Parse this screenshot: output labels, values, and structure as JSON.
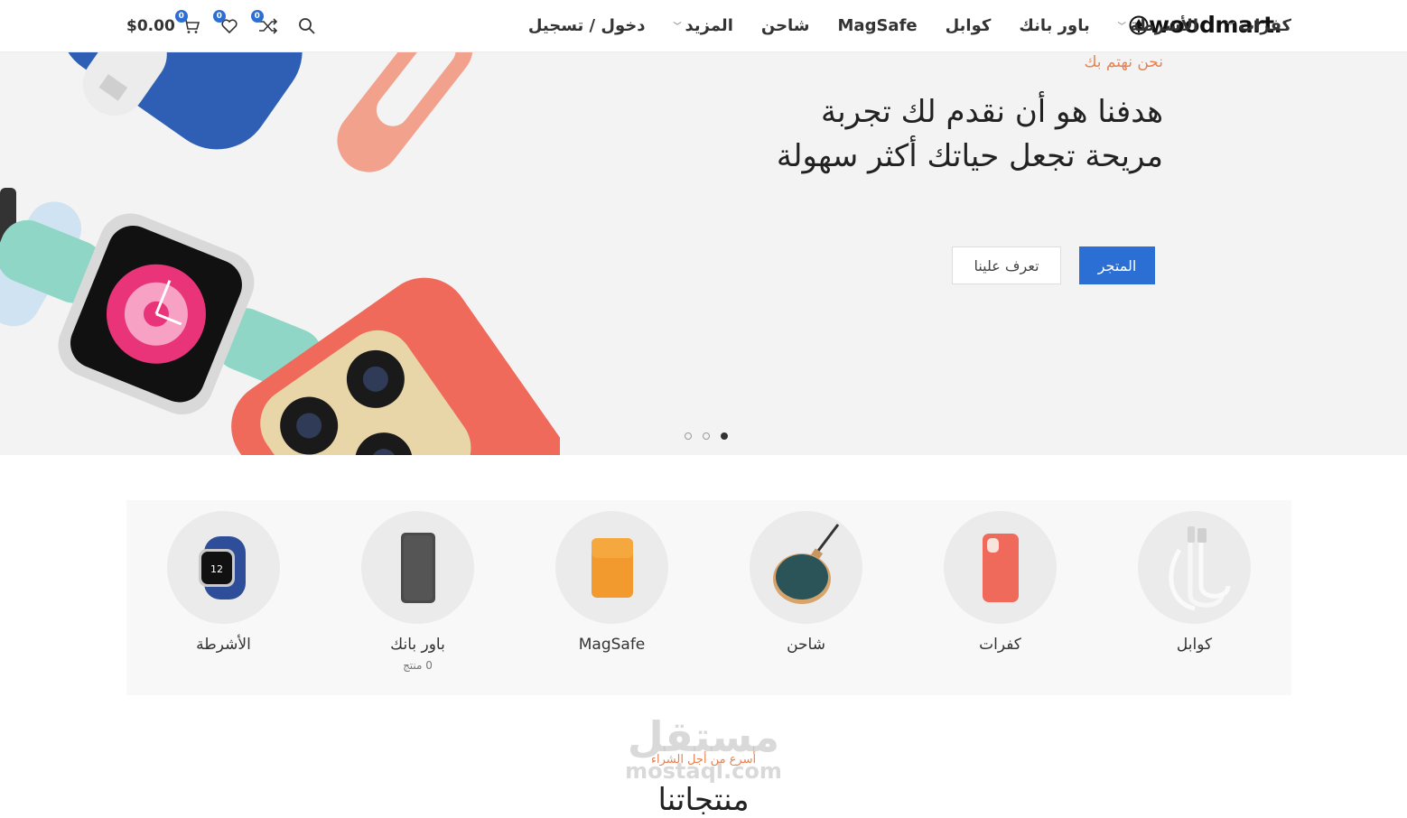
{
  "header": {
    "logo": "woodmart.",
    "nav": [
      {
        "label": "كفرات",
        "has_dropdown": true
      },
      {
        "label": "الأشرطة",
        "has_dropdown": true
      },
      {
        "label": "باور بانك",
        "has_dropdown": false
      },
      {
        "label": "كوابل",
        "has_dropdown": false
      },
      {
        "label": "MagSafe",
        "has_dropdown": false
      },
      {
        "label": "شاحن",
        "has_dropdown": false
      },
      {
        "label": "المزيد",
        "has_dropdown": true
      },
      {
        "label": "دخول / تسجيل",
        "has_dropdown": false
      }
    ],
    "compare_count": "0",
    "wishlist_count": "0",
    "cart_count": "0",
    "cart_total": "$0.00"
  },
  "hero": {
    "subtitle": "نحن نهتم بك",
    "title": "هدفنا هو أن نقدم لك تجربة مريحة تجعل حياتك أكثر سهولة",
    "primary_button": "المتجر",
    "secondary_button": "تعرف علينا",
    "slides_total": 3,
    "active_slide": 1
  },
  "categories": [
    {
      "name": "كوابل",
      "count": "",
      "icon": "cable-icon"
    },
    {
      "name": "كفرات",
      "count": "",
      "icon": "phone-case-icon"
    },
    {
      "name": "شاحن",
      "count": "",
      "icon": "wireless-charger-icon"
    },
    {
      "name": "MagSafe",
      "count": "",
      "icon": "magsafe-wallet-icon"
    },
    {
      "name": "باور بانك",
      "count": "0 منتج",
      "icon": "power-bank-icon"
    },
    {
      "name": "الأشرطة",
      "count": "",
      "icon": "watch-band-icon"
    }
  ],
  "section": {
    "subtitle": "أسرع من أجل الشراء",
    "title": "منتجاتنا"
  },
  "watermark": {
    "arabic": "مستقل",
    "latin": "mostaql.com"
  },
  "colors": {
    "accent": "#2c6fd4",
    "highlight": "#e9814f"
  }
}
